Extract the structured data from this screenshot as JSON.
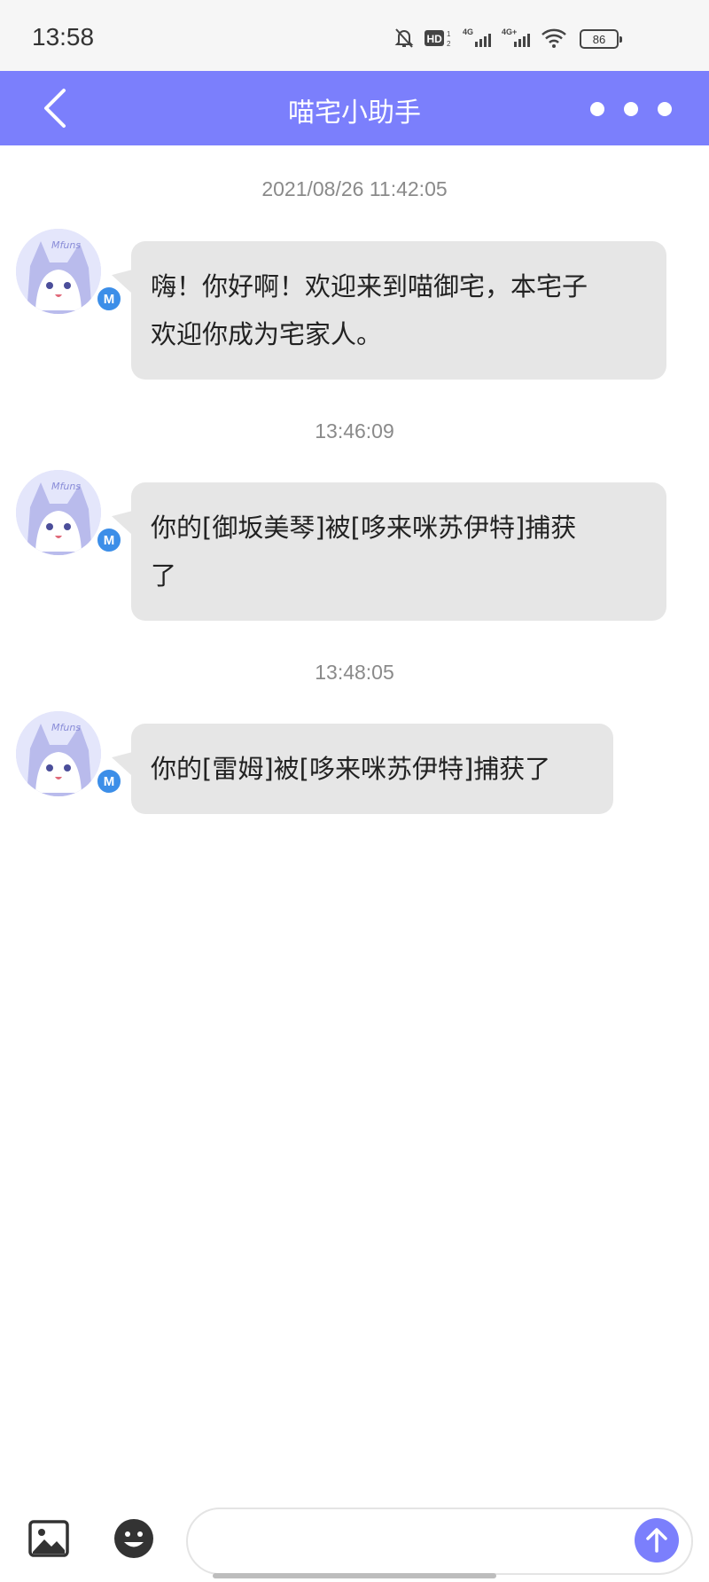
{
  "status_bar": {
    "time": "13:58",
    "icons": [
      "bell-off-icon",
      "hd-icon",
      "signal-4g-icon",
      "signal-4g-plus-icon",
      "wifi-icon"
    ],
    "battery": "86"
  },
  "header": {
    "title": "喵宅小助手",
    "background": "#7b7ffc"
  },
  "messages": [
    {
      "timestamp": "2021/08/26 11:42:05",
      "text_lines": [
        "嗨！你好啊！欢迎来到喵御宅，本宅子",
        "欢迎你成为宅家人。"
      ],
      "avatar_badge": "M"
    },
    {
      "timestamp": "13:46:09",
      "text_lines": [
        "你的[御坂美琴]被[哆来咪苏伊特]捕获",
        "了"
      ],
      "avatar_badge": "M"
    },
    {
      "timestamp": "13:48:05",
      "text_lines": [
        "你的[雷姆]被[哆来咪苏伊特]捕获了"
      ],
      "avatar_badge": "M"
    }
  ],
  "avatar_logo_text": "Mfuns",
  "input_bar": {
    "placeholder": "",
    "icons": [
      "image-icon",
      "emoji-icon",
      "send-arrow-icon"
    ],
    "send_color": "#7b7ffc"
  }
}
